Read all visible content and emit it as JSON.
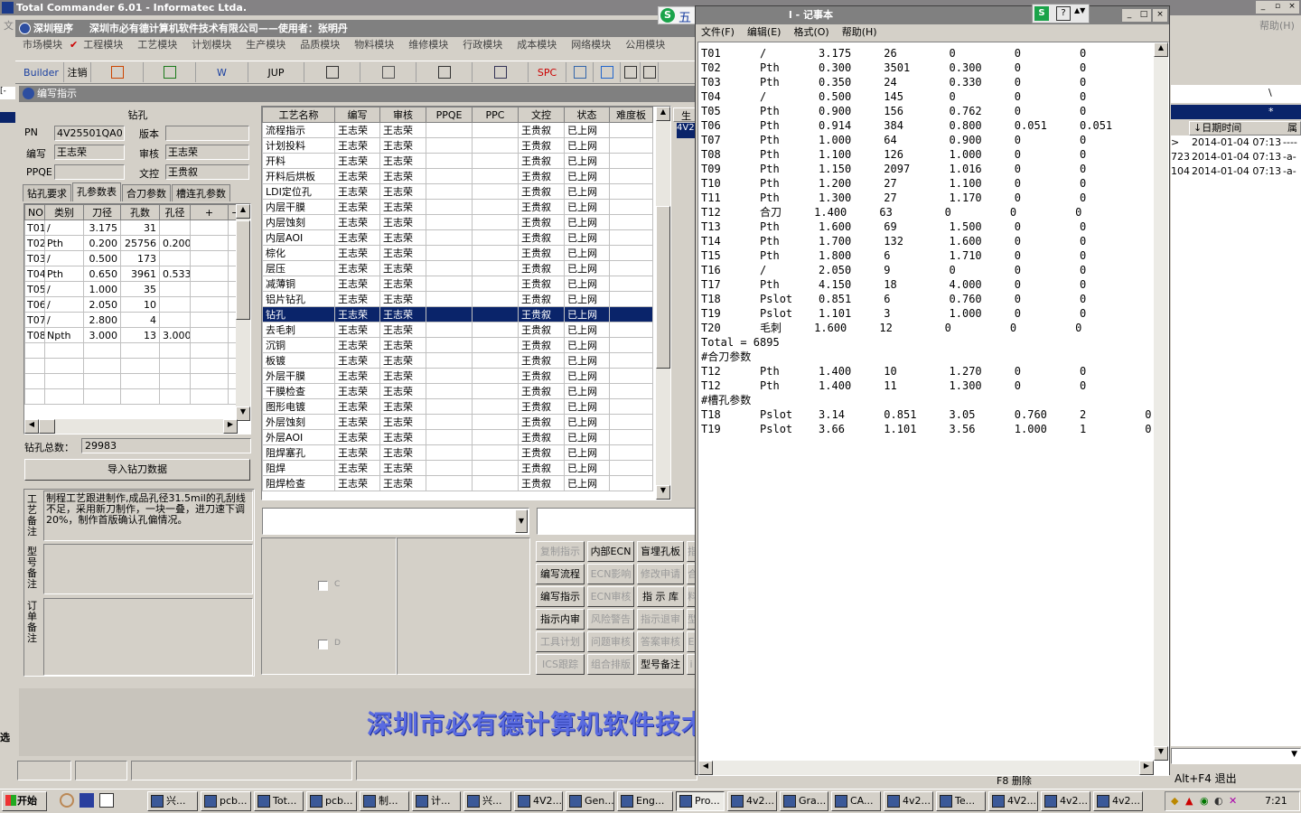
{
  "tc": {
    "title": "Total Commander 6.01 - Informatec Ltda.",
    "menu_item": "文",
    "help": "帮助(H)",
    "right_rows": [
      {
        "a": ">",
        "date": "2014-01-04 07:13",
        "attr": "----"
      },
      {
        "a": "723",
        "date": "2014-01-04 07:13",
        "attr": "-a-"
      },
      {
        "a": "104",
        "date": "2014-01-04 07:13",
        "attr": "-a-"
      }
    ],
    "col_date": "↓日期时间",
    "col_attr": "属",
    "slash": "\\",
    "star": "*",
    "alt_f4": "Alt+F4 退出",
    "f8_delete": "F8 删除",
    "select": "选"
  },
  "app": {
    "title": "深圳程序",
    "company": "深圳市必有德计算机软件技术有限公司——使用者：张明丹",
    "modules": [
      "市场模块",
      "工程模块",
      "工艺模块",
      "计划模块",
      "生产模块",
      "品质模块",
      "物料模块",
      "维修模块",
      "行政模块",
      "成本模块",
      "网络模块",
      "公用模块"
    ],
    "toolbar": [
      "Builder",
      "注销",
      "",
      "",
      "W",
      "JUP",
      "",
      "",
      "",
      "",
      "SPC",
      "",
      "",
      "",
      ""
    ],
    "sub_title": "编写指示",
    "banner": "深圳市必有德计算机软件技术",
    "bottom_letter": "C",
    "bottom_letter2": "D"
  },
  "drill": {
    "heading": "钻孔",
    "pn_label": "PN",
    "pn_value": "4V25501QA0",
    "version_label": "版本",
    "version_value": "",
    "author_label": "编写",
    "author_value": "王志荣",
    "review_label": "审核",
    "review_value": "王志荣",
    "ppqe_label": "PPQE",
    "ppqe_value": "",
    "control_label": "文控",
    "control_value": "王贵叙",
    "tabs": [
      "钻孔要求",
      "孔参数表",
      "合刀参数",
      "槽连孔参数"
    ],
    "cols": [
      "NO",
      "类别",
      "刀径",
      "孔数",
      "孔径",
      "+",
      "−"
    ],
    "rows": [
      [
        "T01",
        "/",
        "3.175",
        "31",
        ""
      ],
      [
        "T02",
        "Pth",
        "0.200",
        "25756",
        "0.200"
      ],
      [
        "T03",
        "/",
        "0.500",
        "173",
        ""
      ],
      [
        "T04",
        "Pth",
        "0.650",
        "3961",
        "0.533"
      ],
      [
        "T05",
        "/",
        "1.000",
        "35",
        ""
      ],
      [
        "T06",
        "/",
        "2.050",
        "10",
        ""
      ],
      [
        "T07",
        "/",
        "2.800",
        "4",
        ""
      ],
      [
        "T08",
        "Npth",
        "3.000",
        "13",
        "3.000"
      ]
    ],
    "total_label": "钻孔总数：",
    "total_value": "29983",
    "import_button": "导入钻刀数据",
    "craft_note_label": "工艺备注",
    "craft_note": "制程工艺跟进制作,成品孔径31.5mil的孔刮线不足，采用新刀制作，一块一叠，进刀速下调20%，制作首版确认孔偏情况。",
    "model_note_label": "型号备注",
    "order_note_label": "订单备注"
  },
  "process": {
    "cols": [
      "工艺名称",
      "编写",
      "审核",
      "PPQE",
      "PPC",
      "文控",
      "状态",
      "难度板"
    ],
    "rows": [
      "流程指示",
      "计划投料",
      "开料",
      "开料后烘板",
      "LDI定位孔",
      "内层干膜",
      "内层蚀刻",
      "内层AOI",
      "棕化",
      "层压",
      "减薄铜",
      "铝片钻孔",
      "钻孔",
      "去毛刺",
      "沉铜",
      "板镀",
      "外层干膜",
      "干膜检查",
      "图形电镀",
      "外层蚀刻",
      "外层AOI",
      "阻焊塞孔",
      "阻焊",
      "阻焊检查"
    ],
    "writer": "王志荣",
    "reviewer": "王志荣",
    "control": "王贵叙",
    "status": "已上网",
    "selected_index": 12,
    "extra_col": "生",
    "extra_val": "4V2"
  },
  "buttons": [
    [
      "复制指示",
      "内部ECN",
      "盲埋孔板",
      "指"
    ],
    [
      "编写流程",
      "ECN影响",
      "修改申请",
      "合"
    ],
    [
      "编写指示",
      "ECN审核",
      "指 示 库",
      "料"
    ],
    [
      "指示内审",
      "风险警告",
      "指示退审",
      "型"
    ],
    [
      "工具计划",
      "问题审核",
      "答案审核",
      "E"
    ],
    [
      "ICS跟踪",
      "组合排版",
      "型号备注",
      "i"
    ]
  ],
  "buttons_enabled": [
    [
      false,
      true,
      true,
      false
    ],
    [
      true,
      false,
      false,
      false
    ],
    [
      true,
      false,
      true,
      false
    ],
    [
      true,
      false,
      false,
      false
    ],
    [
      false,
      false,
      false,
      false
    ],
    [
      false,
      false,
      true,
      false
    ]
  ],
  "notepad": {
    "title": "l - 记事本",
    "menu": [
      "文件(F)",
      "编辑(E)",
      "格式(O)",
      "帮助(H)"
    ],
    "lines": [
      "T01      /        3.175     26        0         0         0",
      "T02      Pth      0.300     3501      0.300     0         0",
      "T03      Pth      0.350     24        0.330     0         0",
      "T04      /        0.500     145       0         0         0",
      "T05      Pth      0.900     156       0.762     0         0",
      "T06      Pth      0.914     384       0.800     0.051     0.051",
      "T07      Pth      1.000     64        0.900     0         0",
      "T08      Pth      1.100     126       1.000     0         0",
      "T09      Pth      1.150     2097      1.016     0         0",
      "T10      Pth      1.200     27        1.100     0         0",
      "T11      Pth      1.300     27        1.170     0         0",
      "T12      合刀     1.400     63        0         0         0",
      "T13      Pth      1.600     69        1.500     0         0",
      "T14      Pth      1.700     132       1.600     0         0",
      "T15      Pth      1.800     6         1.710     0         0",
      "T16      /        2.050     9         0         0         0",
      "T17      Pth      4.150     18        4.000     0         0",
      "T18      Pslot    0.851     6         0.760     0         0",
      "T19      Pslot    1.101     3         1.000     0         0",
      "T20      毛刺     1.600     12        0         0         0",
      "Total = 6895",
      "#合刀参数",
      "T12      Pth      1.400     10        1.270     0         0",
      "T12      Pth      1.400     11        1.300     0         0",
      "#槽孔参数",
      "T18      Pslot    3.14      0.851     3.05      0.760     2         0",
      "T19      Pslot    3.66      1.101     3.56      1.000     1         0"
    ]
  },
  "ime": {
    "s": "S",
    "wu": "五"
  },
  "taskbar": {
    "start": "开始",
    "items": [
      "兴...",
      "pcb...",
      "Tot...",
      "pcb...",
      "制...",
      "计...",
      "兴...",
      "4V2...",
      "Gen...",
      "Eng...",
      "Pro...",
      "4v2...",
      "Gra...",
      "CA...",
      "4v2...",
      "Te...",
      "4V2...",
      "4v2...",
      "4v2..."
    ],
    "active_index": 10,
    "clock": "7:21"
  }
}
